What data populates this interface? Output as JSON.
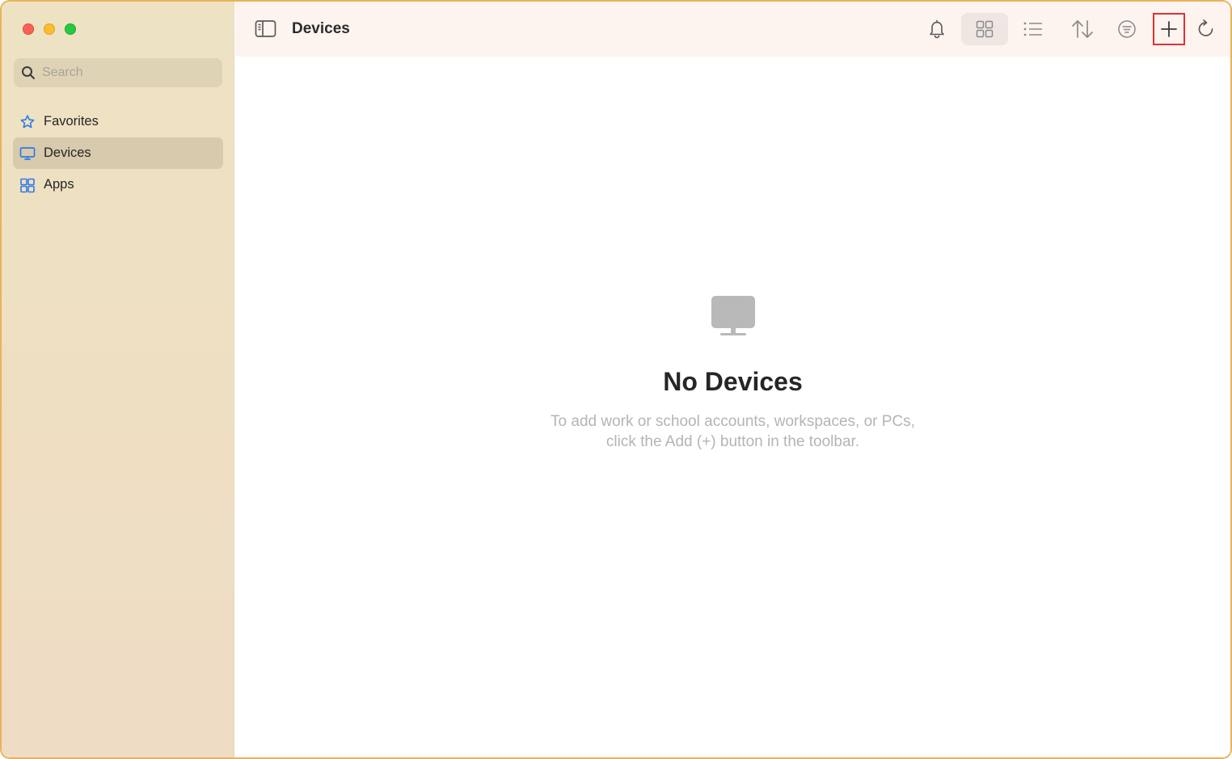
{
  "sidebar": {
    "search": {
      "placeholder": "Search"
    },
    "items": [
      {
        "label": "Favorites",
        "icon": "star-icon",
        "active": false
      },
      {
        "label": "Devices",
        "icon": "monitor-icon",
        "active": true
      },
      {
        "label": "Apps",
        "icon": "apps-grid-icon",
        "active": false
      }
    ]
  },
  "toolbar": {
    "title": "Devices"
  },
  "empty_state": {
    "title": "No Devices",
    "message_line1": "To add work or school accounts, workspaces, or PCs,",
    "message_line2": "click the Add (+) button in the toolbar."
  },
  "colors": {
    "accent_blue": "#2f7ae5",
    "highlight_red": "#e03030",
    "window_border": "#e9b25a"
  }
}
